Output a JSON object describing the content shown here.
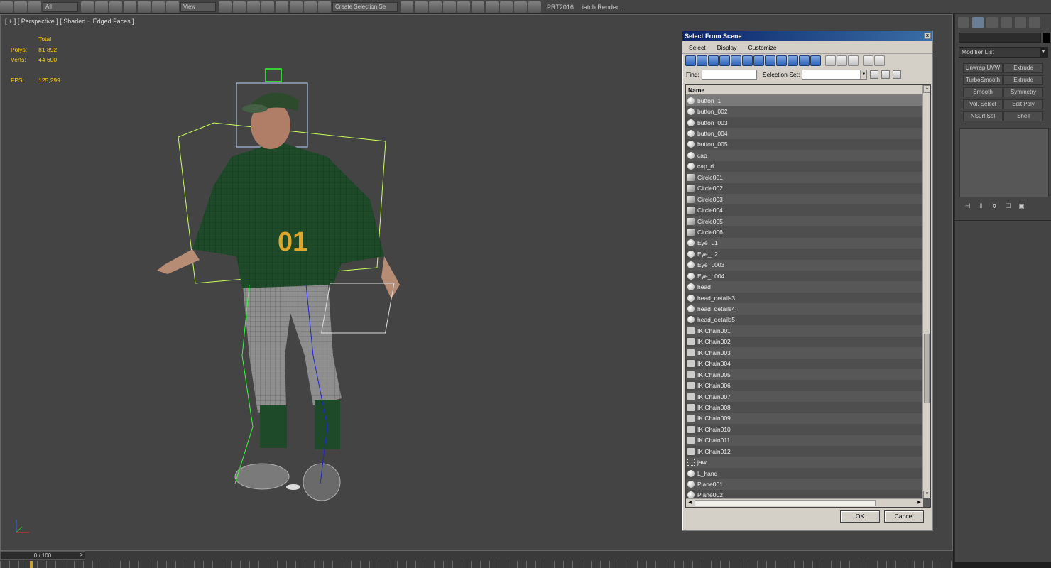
{
  "toolbar": {
    "filter_value": "All",
    "coord_value": "View",
    "selection_set_placeholder": "Create Selection Se",
    "prt_label": "PRT2016",
    "batch_render_label": "iatch Render..."
  },
  "viewport": {
    "label": "[ + ] [ Perspective ] [ Shaded + Edged Faces ]",
    "stats": {
      "total_label": "Total",
      "polys_label": "Polys:",
      "polys_value": "81 892",
      "verts_label": "Verts:",
      "verts_value": "44 600",
      "fps_label": "FPS:",
      "fps_value": "125,299"
    },
    "jersey_number": "01"
  },
  "command_panel": {
    "modifier_list_label": "Modifier List",
    "modifiers": [
      "Unwrap UVW",
      "Extrude",
      "TurboSmooth",
      "Extrude",
      "Smooth",
      "Symmetry",
      "Vol. Select",
      "Edit Poly",
      "NSurf Sel",
      "Shell"
    ]
  },
  "timeline": {
    "frame_label": "0 / 100",
    "next_label": ">"
  },
  "dialog": {
    "title": "Select From Scene",
    "close_label": "x",
    "menu": [
      "Select",
      "Display",
      "Customize"
    ],
    "find_label": "Find:",
    "selection_set_label": "Selection Set:",
    "column_name": "Name",
    "ok_label": "OK",
    "cancel_label": "Cancel",
    "items": [
      {
        "name": "button_1",
        "icon": "sphere-icon",
        "selected": true
      },
      {
        "name": "button_002",
        "icon": "sphere-icon"
      },
      {
        "name": "button_003",
        "icon": "sphere-icon"
      },
      {
        "name": "button_004",
        "icon": "sphere-icon"
      },
      {
        "name": "button_005",
        "icon": "sphere-icon"
      },
      {
        "name": "cap",
        "icon": "sphere-icon"
      },
      {
        "name": "cap_d",
        "icon": "sphere-icon"
      },
      {
        "name": "Circle001",
        "icon": "shape-icon"
      },
      {
        "name": "Circle002",
        "icon": "shape-icon"
      },
      {
        "name": "Circle003",
        "icon": "shape-icon"
      },
      {
        "name": "Circle004",
        "icon": "shape-icon"
      },
      {
        "name": "Circle005",
        "icon": "shape-icon"
      },
      {
        "name": "Circle006",
        "icon": "shape-icon"
      },
      {
        "name": "Eye_L1",
        "icon": "sphere-icon"
      },
      {
        "name": "Eye_L2",
        "icon": "sphere-icon"
      },
      {
        "name": "Eye_L003",
        "icon": "sphere-icon"
      },
      {
        "name": "Eye_L004",
        "icon": "sphere-icon"
      },
      {
        "name": "head",
        "icon": "sphere-icon"
      },
      {
        "name": "head_details3",
        "icon": "sphere-icon"
      },
      {
        "name": "head_details4",
        "icon": "sphere-icon"
      },
      {
        "name": "head_details5",
        "icon": "sphere-icon"
      },
      {
        "name": "IK Chain001",
        "icon": "ik-chain-icon"
      },
      {
        "name": "IK Chain002",
        "icon": "ik-chain-icon"
      },
      {
        "name": "IK Chain003",
        "icon": "ik-chain-icon"
      },
      {
        "name": "IK Chain004",
        "icon": "ik-chain-icon"
      },
      {
        "name": "IK Chain005",
        "icon": "ik-chain-icon"
      },
      {
        "name": "IK Chain006",
        "icon": "ik-chain-icon"
      },
      {
        "name": "IK Chain007",
        "icon": "ik-chain-icon"
      },
      {
        "name": "IK Chain008",
        "icon": "ik-chain-icon"
      },
      {
        "name": "IK Chain009",
        "icon": "ik-chain-icon"
      },
      {
        "name": "IK Chain010",
        "icon": "ik-chain-icon"
      },
      {
        "name": "IK Chain011",
        "icon": "ik-chain-icon"
      },
      {
        "name": "IK Chain012",
        "icon": "ik-chain-icon"
      },
      {
        "name": "jaw",
        "icon": "dummy-icon"
      },
      {
        "name": "L_hand",
        "icon": "sphere-icon"
      },
      {
        "name": "Plane001",
        "icon": "sphere-icon"
      },
      {
        "name": "Plane002",
        "icon": "sphere-icon"
      }
    ]
  },
  "colors": {
    "viewport_bg": "#444444",
    "stats_text": "#ffd000",
    "jersey": "#1f4a2a",
    "jersey_number": "#e0a62a",
    "title_bar": "#0a246a"
  }
}
